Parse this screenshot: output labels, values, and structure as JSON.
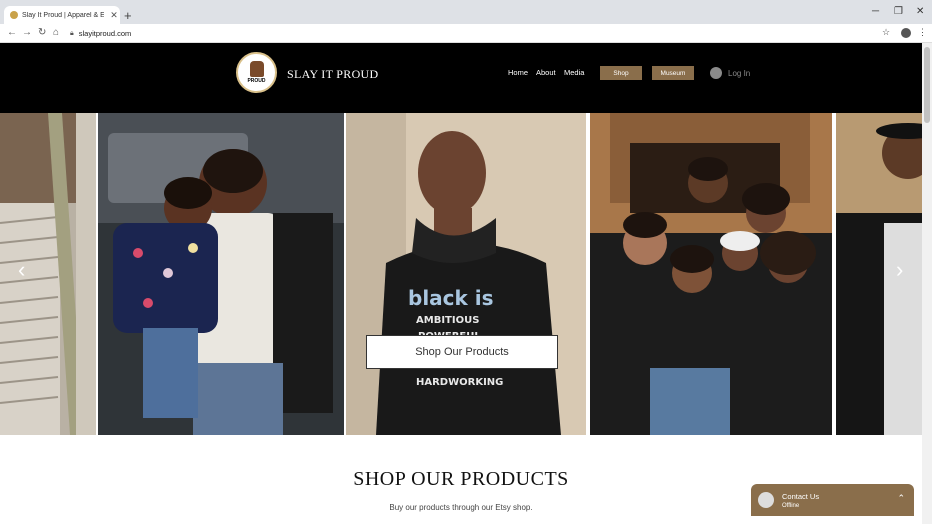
{
  "browser": {
    "tab_title": "Slay It Proud | Apparel & Educati",
    "new_tab_label": "+",
    "close_tab": "✕",
    "minimize": "─",
    "restore": "❐",
    "close_window": "✕",
    "url": "slayitproud.com",
    "back": "←",
    "forward": "→",
    "reload": "↻",
    "home": "⌂",
    "bookmark": "☆",
    "menu": "⋮"
  },
  "site": {
    "logo_text": "PROUD",
    "brand": "SLAY IT PROUD",
    "nav": {
      "home": "Home",
      "about": "About",
      "media": "Media",
      "shop": "Shop",
      "museum": "Museum",
      "login": "Log In"
    },
    "gallery": {
      "prev_arrow": "‹",
      "next_arrow": "›",
      "cta": "Shop Our Products",
      "shirt_text_1": "black is",
      "shirt_text_2": "AMBITIOUS",
      "shirt_text_3": "POWERFUL",
      "shirt_text_4": "HARDWORKING"
    },
    "section": {
      "title": "SHOP OUR PRODUCTS",
      "subtitle": "Buy our products through our Etsy shop."
    },
    "chat": {
      "title": "Contact Us",
      "status": "Offline",
      "toggle": "⌃"
    }
  },
  "colors": {
    "accent": "#8a6e4b",
    "header": "#000000"
  }
}
